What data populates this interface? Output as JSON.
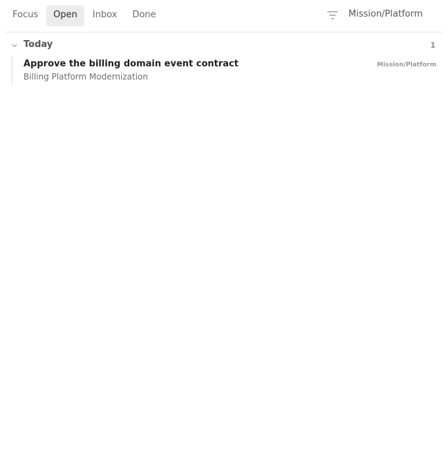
{
  "tabs": [
    {
      "label": "Focus",
      "active": false
    },
    {
      "label": "Open",
      "active": true
    },
    {
      "label": "Inbox",
      "active": false
    },
    {
      "label": "Done",
      "active": false
    }
  ],
  "filter": {
    "icon": "filter-icon",
    "scope_label": "Mission/Platform"
  },
  "group": {
    "icon": "chevron-down-icon",
    "title": "Today",
    "count": "1"
  },
  "tasks": [
    {
      "title": "Approve the billing domain event contract",
      "subtitle": "Billing Platform Modernization",
      "tag": "Mission/Platform"
    }
  ]
}
